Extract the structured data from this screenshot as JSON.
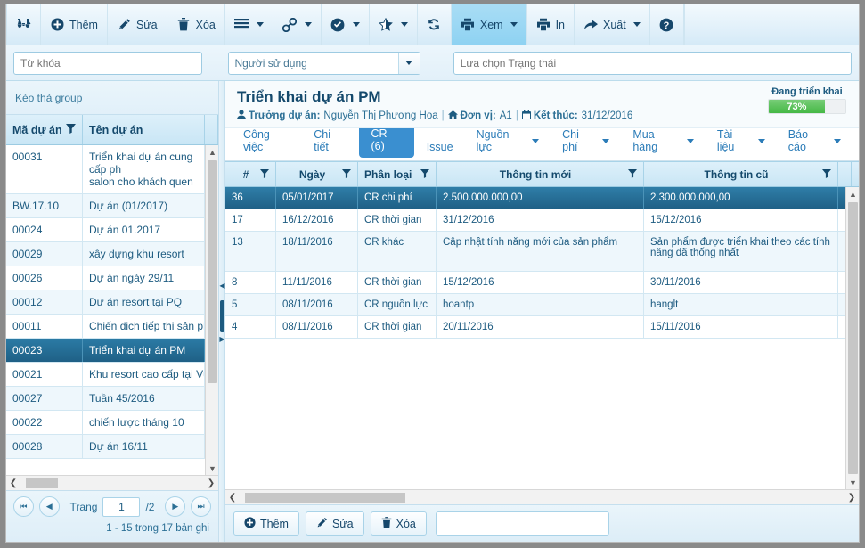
{
  "toolbar": {
    "buttons": [
      {
        "label": "",
        "icon": "binoculars-icon",
        "name": "search-tool-button",
        "caret": false,
        "active": false
      },
      {
        "label": "Thêm",
        "icon": "plus-circle-icon",
        "name": "add-button",
        "caret": false,
        "active": false
      },
      {
        "label": "Sửa",
        "icon": "pencil-icon",
        "name": "edit-button",
        "caret": false,
        "active": false
      },
      {
        "label": "Xóa",
        "icon": "trash-icon",
        "name": "delete-button",
        "caret": false,
        "active": false
      },
      {
        "label": "",
        "icon": "hamburger-menu-icon",
        "name": "menu-button",
        "caret": true,
        "active": false
      },
      {
        "label": "",
        "icon": "link-icon",
        "name": "link-button",
        "caret": true,
        "active": false
      },
      {
        "label": "",
        "icon": "check-circle-icon",
        "name": "approve-button",
        "caret": true,
        "active": false
      },
      {
        "label": "",
        "icon": "star-icon",
        "name": "favorite-button",
        "caret": true,
        "active": false
      },
      {
        "label": "",
        "icon": "refresh-icon",
        "name": "refresh-button",
        "caret": false,
        "active": false
      },
      {
        "label": "Xem",
        "icon": "printer-icon",
        "name": "view-button",
        "caret": true,
        "active": true
      },
      {
        "label": "In",
        "icon": "printer-icon",
        "name": "print-button",
        "caret": false,
        "active": false
      },
      {
        "label": "Xuất",
        "icon": "export-arrow-icon",
        "name": "export-button",
        "caret": true,
        "active": false
      },
      {
        "label": "",
        "icon": "help-circle-icon",
        "name": "help-button",
        "caret": false,
        "active": false
      }
    ]
  },
  "filterbar": {
    "keyword_placeholder": "Từ khóa",
    "keyword_value": "",
    "user_value": "Người sử dụng",
    "status_placeholder": "Lựa chọn Trạng thái",
    "status_value": ""
  },
  "left_panel": {
    "group_bar": "Kéo thả group",
    "columns": [
      "Mã dự án",
      "Tên dự án"
    ],
    "rows": [
      {
        "code": "00031",
        "name": "Triển khai dự án cung cấp ph\nsalon cho khách quen",
        "selected": false,
        "tall": true
      },
      {
        "code": "BW.17.10",
        "name": "Dự án (01/2017)",
        "selected": false
      },
      {
        "code": "00024",
        "name": "Dự án 01.2017",
        "selected": false
      },
      {
        "code": "00029",
        "name": "xây dựng khu resort",
        "selected": false
      },
      {
        "code": "00026",
        "name": "Dự án ngày 29/11",
        "selected": false
      },
      {
        "code": "00012",
        "name": "Dự án resort tại PQ",
        "selected": false
      },
      {
        "code": "00011",
        "name": "Chiến dịch tiếp thị sản phẩn",
        "selected": false
      },
      {
        "code": "00023",
        "name": "Triển khai dự án PM",
        "selected": true
      },
      {
        "code": "00021",
        "name": "Khu resort cao cấp tại Vũn",
        "selected": false
      },
      {
        "code": "00027",
        "name": "Tuần 45/2016",
        "selected": false
      },
      {
        "code": "00022",
        "name": "chiến lược tháng 10",
        "selected": false
      },
      {
        "code": "00028",
        "name": "Dự án 16/11",
        "selected": false
      }
    ],
    "pager": {
      "page_label": "Trang",
      "page_value": "1",
      "page_total": "/2",
      "records": "1 - 15 trong 17 bản ghi"
    }
  },
  "right_panel": {
    "title": "Triển khai dự án PM",
    "meta": {
      "manager_label": "Trưởng dự án:",
      "manager_value": "Nguyễn Thị Phương Hoa",
      "unit_label": "Đơn vị:",
      "unit_value": "A1",
      "end_label": "Kết thúc:",
      "end_value": "31/12/2016"
    },
    "progress": {
      "label": "Đang triển khai",
      "value": "73%",
      "percent": 73,
      "color": "#45b845"
    },
    "tabs": [
      {
        "label": "Công việc",
        "caret": false,
        "active": false
      },
      {
        "label": "Chi tiết",
        "caret": false,
        "active": false
      },
      {
        "label": "CR (6)",
        "caret": false,
        "active": true
      },
      {
        "label": "Issue",
        "caret": false,
        "active": false
      },
      {
        "label": "Nguồn lực",
        "caret": true,
        "active": false
      },
      {
        "label": "Chi phí",
        "caret": true,
        "active": false
      },
      {
        "label": "Mua hàng",
        "caret": true,
        "active": false
      },
      {
        "label": "Tài liệu",
        "caret": true,
        "active": false
      },
      {
        "label": "Báo cáo",
        "caret": true,
        "active": false
      }
    ],
    "grid": {
      "columns": [
        "#",
        "Ngày",
        "Phân loại",
        "Thông tin mới",
        "Thông tin cũ"
      ],
      "rows": [
        {
          "num": "36",
          "date": "05/01/2017",
          "type": "CR chi phí",
          "new": "2.500.000.000,00",
          "old": "2.300.000.000,00",
          "selected": true
        },
        {
          "num": "17",
          "date": "16/12/2016",
          "type": "CR thời gian",
          "new": "31/12/2016",
          "old": "15/12/2016",
          "selected": false
        },
        {
          "num": "13",
          "date": "18/11/2016",
          "type": "CR khác",
          "new": "Cập nhật tính năng mới của sản phẩm",
          "old": "Sản phẩm được triển khai theo các tính năng đã thống nhất",
          "selected": false,
          "tall": true
        },
        {
          "num": "8",
          "date": "11/11/2016",
          "type": "CR thời gian",
          "new": "15/12/2016",
          "old": "30/11/2016",
          "selected": false
        },
        {
          "num": "5",
          "date": "08/11/2016",
          "type": "CR nguồn lực",
          "new": "hoantp",
          "old": "hanglt",
          "selected": false
        },
        {
          "num": "4",
          "date": "08/11/2016",
          "type": "CR thời gian",
          "new": "20/11/2016",
          "old": "15/11/2016",
          "selected": false
        }
      ]
    },
    "footer": {
      "add_label": "Thêm",
      "edit_label": "Sửa",
      "delete_label": "Xóa",
      "note_value": ""
    }
  },
  "colors": {
    "accent": "#2f7ea8",
    "tab_active": "#3a8fd0",
    "progress_green": "#45b845",
    "header_blue": "#c9e6f5"
  }
}
